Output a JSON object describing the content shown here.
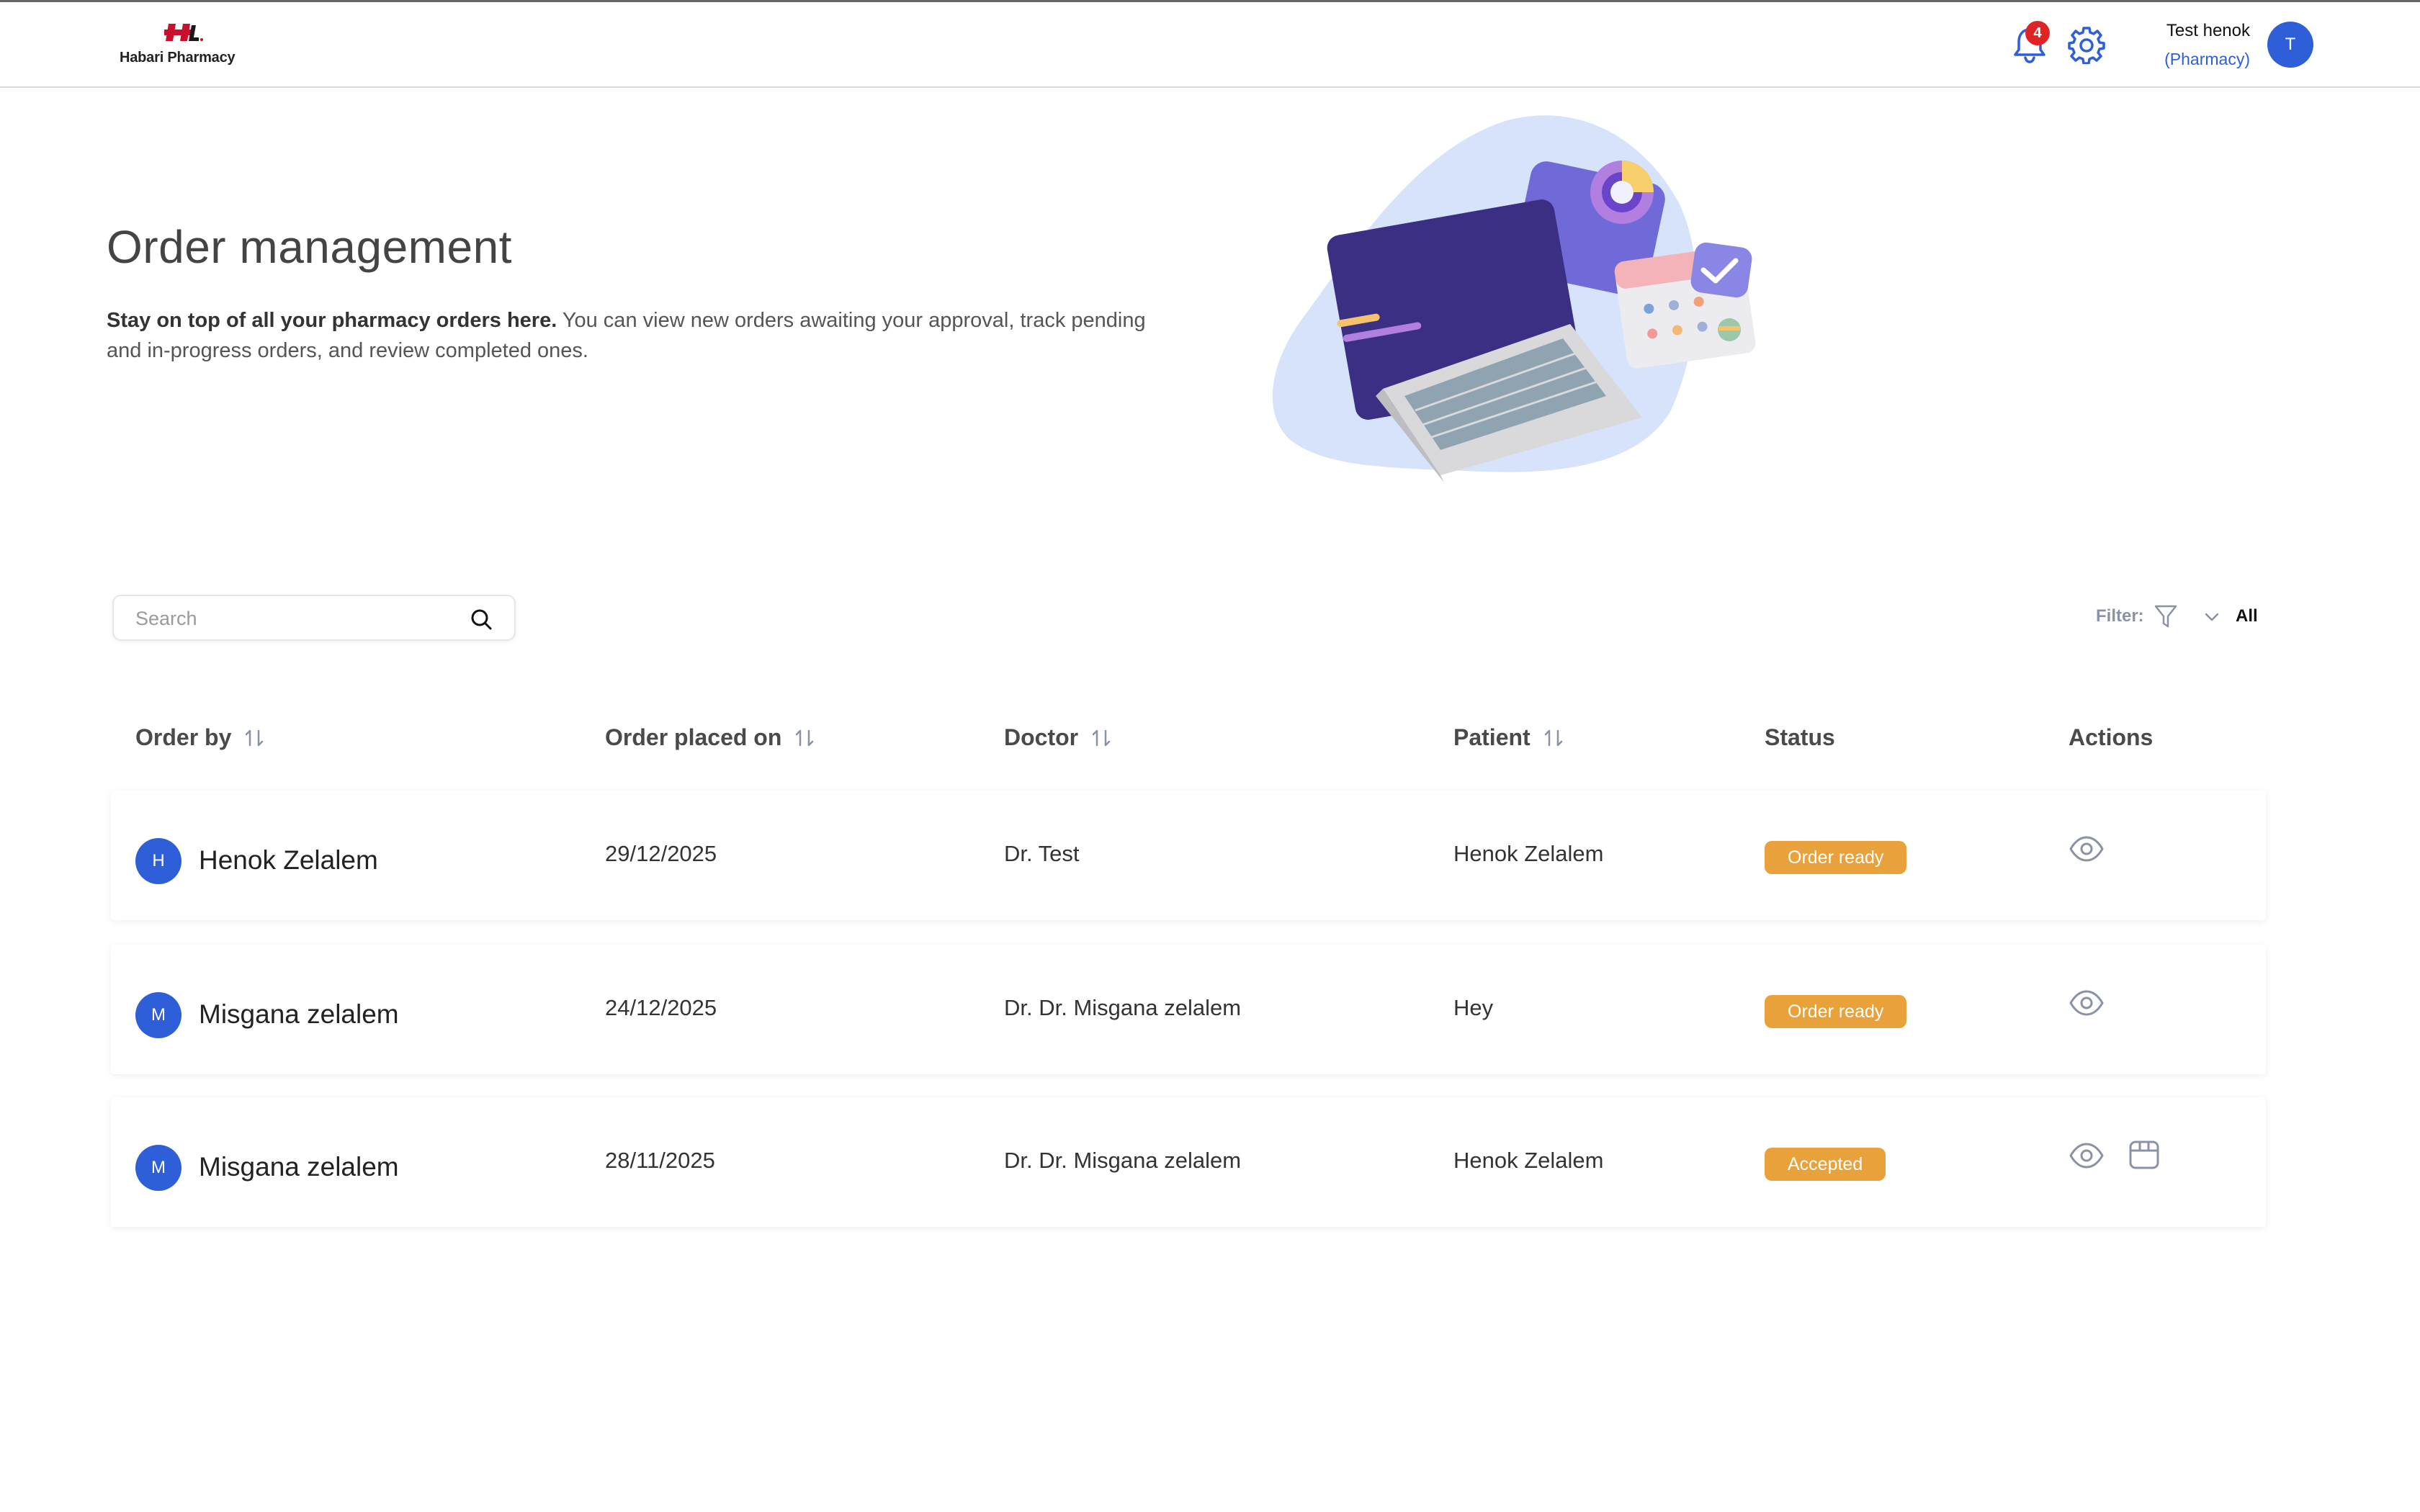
{
  "header": {
    "brand": "Habari Pharmacy",
    "notification_count": "4",
    "user_name": "Test henok",
    "user_role": "(Pharmacy)",
    "avatar_initial": "T"
  },
  "hero": {
    "title": "Order management",
    "desc_bold": "Stay on top of all your pharmacy orders here.",
    "desc_rest": " You can view new orders awaiting your approval, track pending and in-progress orders, and review completed ones."
  },
  "toolbar": {
    "search_placeholder": "Search",
    "filter_label": "Filter:",
    "filter_value": "All"
  },
  "table": {
    "columns": {
      "order_by": "Order by",
      "placed_on": "Order placed on",
      "doctor": "Doctor",
      "patient": "Patient",
      "status": "Status",
      "actions": "Actions"
    },
    "rows": [
      {
        "initial": "H",
        "order_by": "Henok Zelalem",
        "placed_on": "29/12/2025",
        "doctor": "Dr. Test",
        "patient": "Henok Zelalem",
        "status": "Order ready"
      },
      {
        "initial": "M",
        "order_by": "Misgana zelalem",
        "placed_on": "24/12/2025",
        "doctor": "Dr. Dr. Misgana zelalem",
        "patient": "Hey",
        "status": "Order ready"
      },
      {
        "initial": "M",
        "order_by": "Misgana zelalem",
        "placed_on": "28/11/2025",
        "doctor": "Dr. Dr. Misgana zelalem",
        "patient": "Henok Zelalem",
        "status": "Accepted"
      }
    ]
  },
  "colors": {
    "accent_blue": "#2f5fd8",
    "status_orange": "#e9a23b",
    "brand_red": "#c8102e"
  }
}
